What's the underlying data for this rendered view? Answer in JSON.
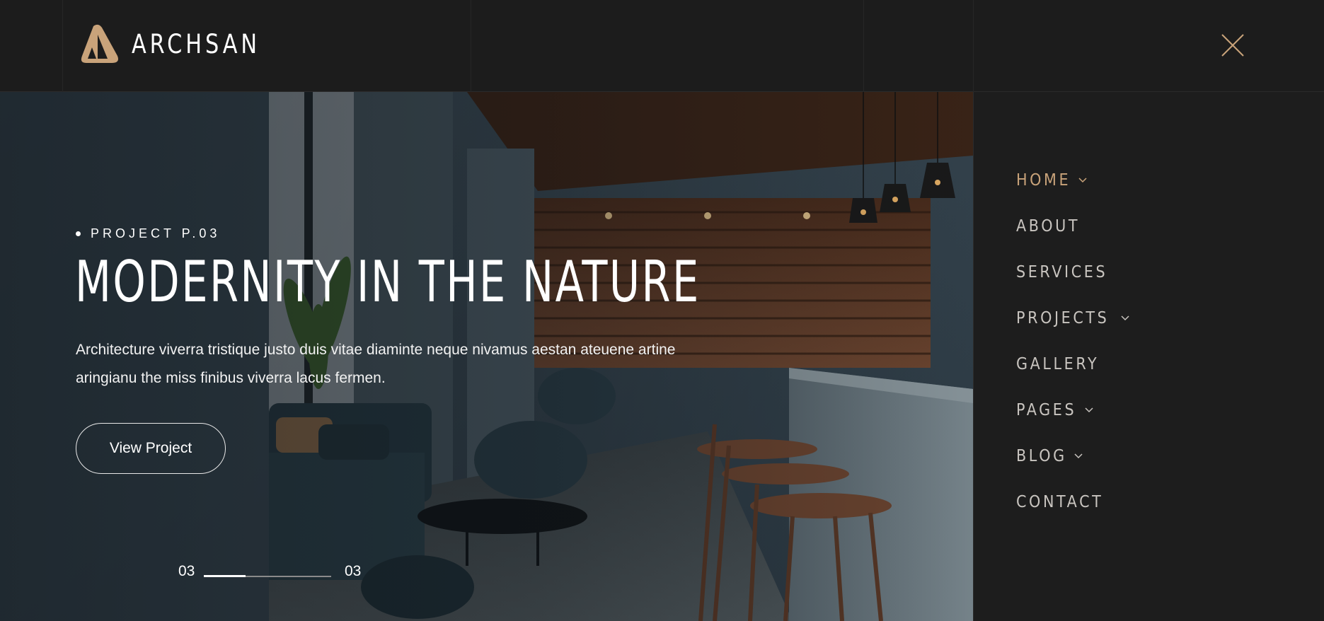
{
  "brand": {
    "name": "ARCHSAN",
    "accent": "#c9a37a"
  },
  "header": {
    "close_icon": "close-icon"
  },
  "hero": {
    "eyebrow": "PROJECT P.03",
    "title": "MODERNITY IN THE NATURE",
    "description": "Architecture viverra tristique justo duis vitae diaminte neque nivamus aestan ateuene artine aringianu the miss finibus viverra lacus fermen.",
    "cta": "View Project",
    "pager": {
      "current": "03",
      "total": "03",
      "progress": 0.33
    }
  },
  "menu": {
    "items": [
      {
        "label": "HOME",
        "active": true,
        "has_submenu": true
      },
      {
        "label": "ABOUT",
        "active": false,
        "has_submenu": false
      },
      {
        "label": "SERVICES",
        "active": false,
        "has_submenu": false
      },
      {
        "label": "PROJECTS",
        "active": false,
        "has_submenu": true
      },
      {
        "label": "GALLERY",
        "active": false,
        "has_submenu": false
      },
      {
        "label": "PAGES",
        "active": false,
        "has_submenu": true
      },
      {
        "label": "BLOG",
        "active": false,
        "has_submenu": true
      },
      {
        "label": "CONTACT",
        "active": false,
        "has_submenu": false
      }
    ]
  }
}
